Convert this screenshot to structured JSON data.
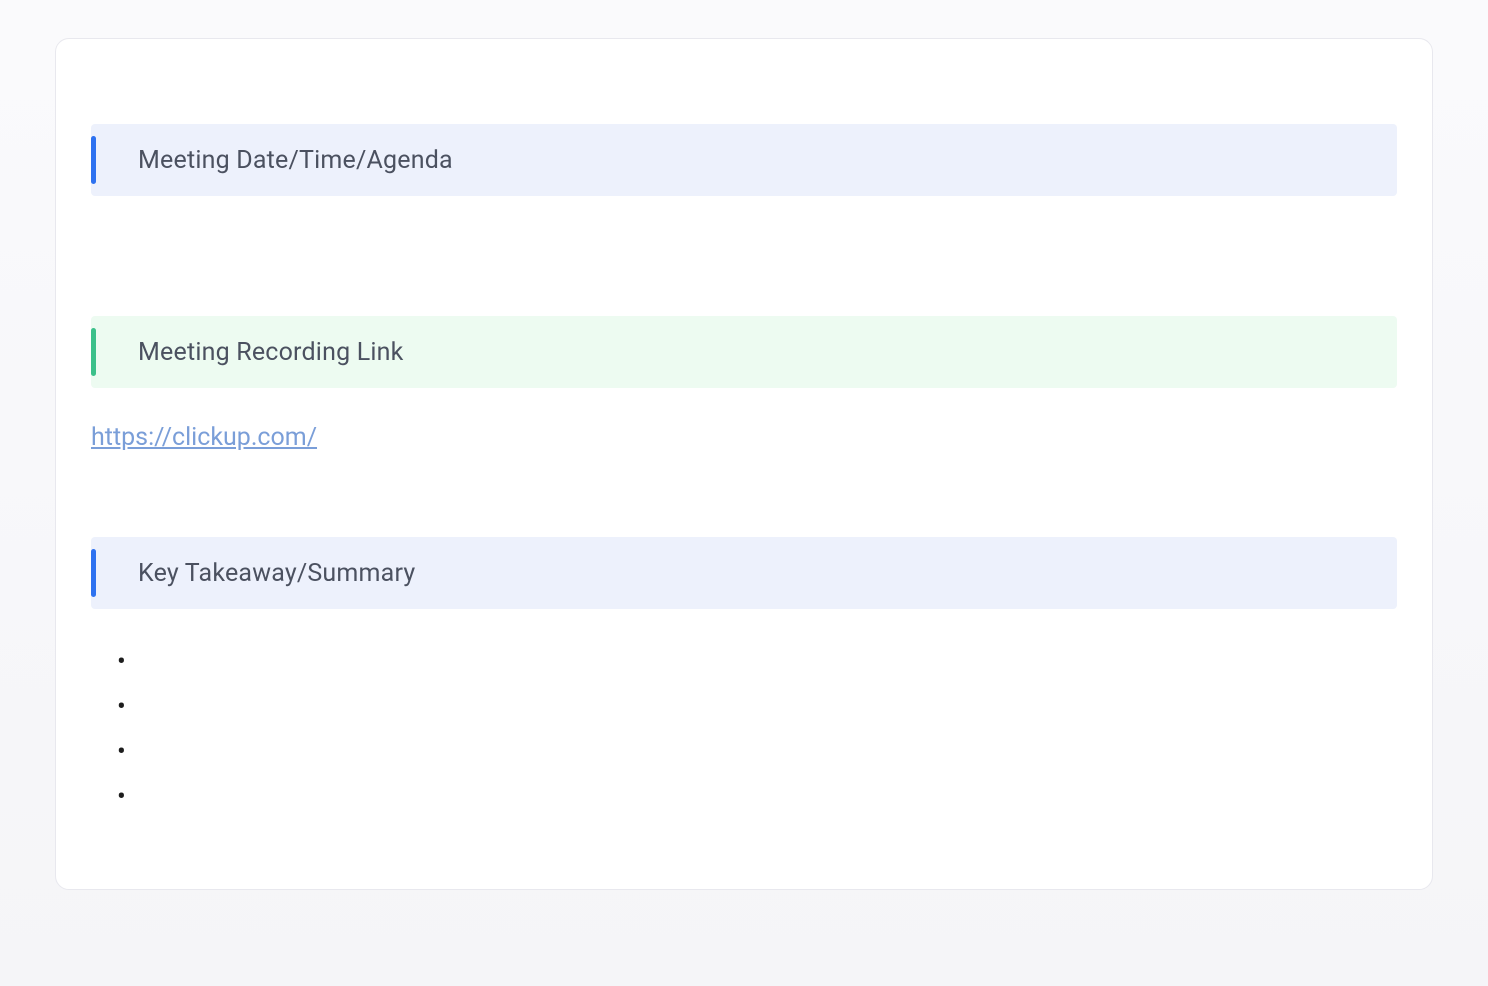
{
  "sections": {
    "meeting_info": {
      "title": "Meeting Date/Time/Agenda"
    },
    "recording": {
      "title": "Meeting Recording Link",
      "link_text": "https://clickup.com/",
      "link_href": "https://clickup.com/"
    },
    "summary": {
      "title": "Key Takeaway/Summary",
      "bullets": [
        "",
        "",
        "",
        ""
      ]
    }
  }
}
